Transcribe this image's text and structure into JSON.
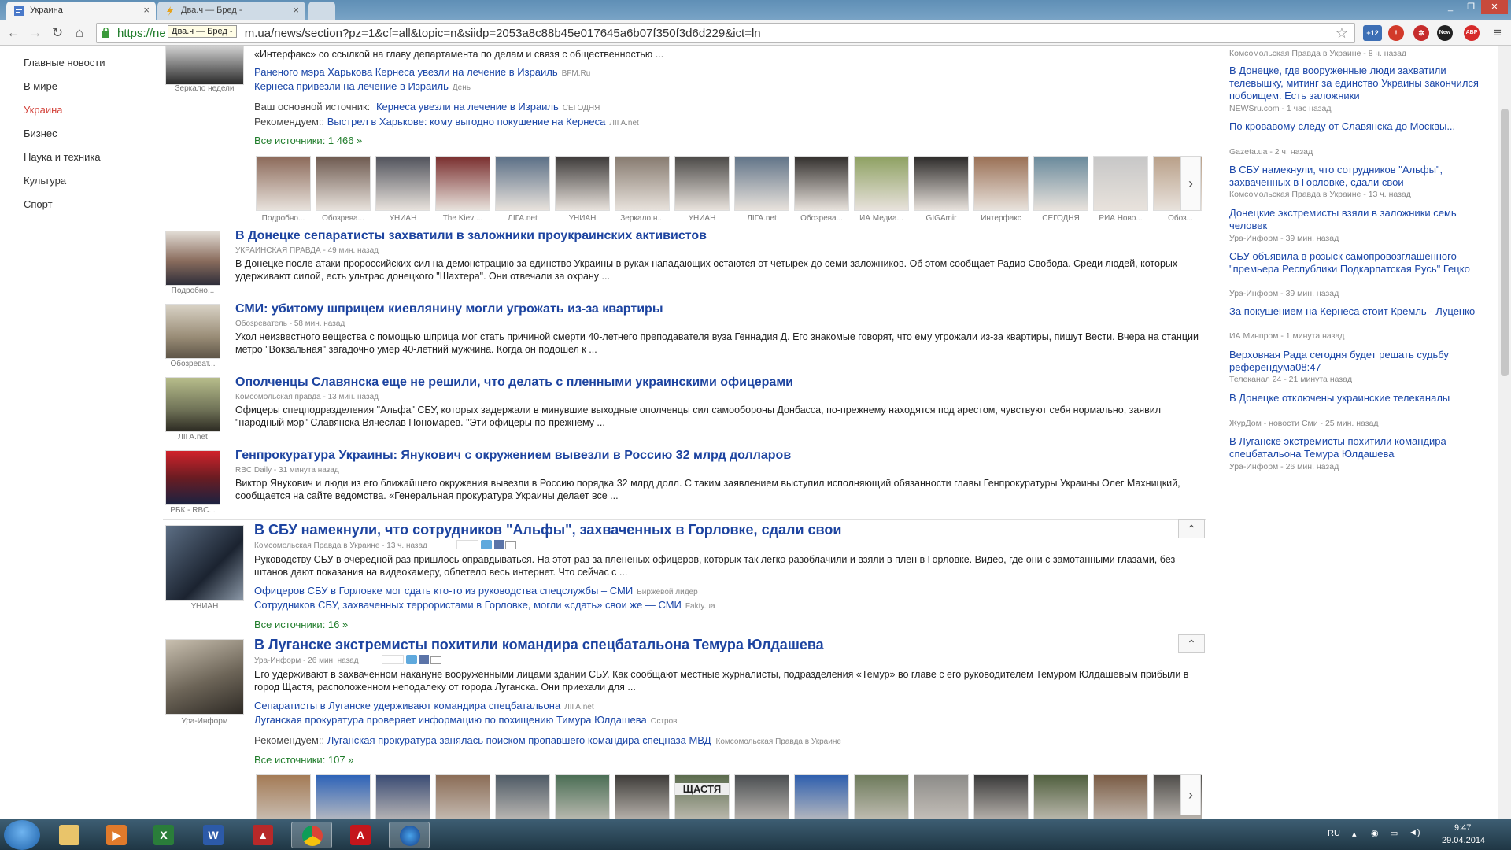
{
  "browser": {
    "tabs": [
      {
        "title": "Украина",
        "active": true
      },
      {
        "title": "Два.ч — Бред -",
        "active": false
      }
    ],
    "url": "https://news.google.com.ua/news/section?pz=1&cf=all&topic=n&siidp=2053a8c88b45e017645a6b07f350f3d6d229&ict=ln",
    "url_visible": "https://ne",
    "url_tail": "m.ua/news/section?pz=1&cf=all&topic=n&siidp=2053a8c88b45e017645a6b07f350f3d6d229&ict=ln",
    "tooltip": "Два.ч — Бред -",
    "ext_badge": "+12",
    "ext_new": "New",
    "ext_abp": "ABP"
  },
  "left_nav": [
    {
      "label": "Главные новости",
      "active": false
    },
    {
      "label": "В мире",
      "active": false
    },
    {
      "label": "Украина",
      "active": true
    },
    {
      "label": "Бизнес",
      "active": false
    },
    {
      "label": "Наука и техника",
      "active": false
    },
    {
      "label": "Культура",
      "active": false
    },
    {
      "label": "Спорт",
      "active": false
    }
  ],
  "story1": {
    "thumb_caption": "Зеркало недели",
    "snippet_tail": "«Интерфакс» со ссылкой на главу департамента по делам и связя с общественностью ...",
    "related": [
      {
        "text": "Раненого мэра Харькова Кернеса увезли на лечение в Израиль",
        "src": "BFM.Ru"
      },
      {
        "text": "Кернеса привезли на лечение в Израиль",
        "src": "День"
      }
    ],
    "main_source_label": "Ваш основной источник:",
    "main_source_link": "Кернеса увезли на лечение в Израиль",
    "main_source_src": "СЕГОДНЯ",
    "recommend_label": "Рекомендуем::",
    "recommend_link": "Выстрел в Харькове: кому выгодно покушение на Кернеса",
    "recommend_src": "ЛIГА.net",
    "all_sources": "Все источники: 1 466 »",
    "strip_captions": [
      "Подробно...",
      "Обозрева...",
      "УНИАН",
      "The Kiev ...",
      "ЛIГА.net",
      "УНИАН",
      "Зеркало н...",
      "УНИАН",
      "ЛIГА.net",
      "Обозрева...",
      "ИА Медиа...",
      "GIGAmir",
      "Интерфакс",
      "СЕГОДНЯ",
      "РИА Ново...",
      "Обоз..."
    ]
  },
  "small_stories": [
    {
      "title": "В Донецке сепаратисты захватили в заложники проукраинских активистов",
      "meta": "УКРАИНСКАЯ ПРАВДА - 49 мин. назад",
      "snippet": "В Донецке после атаки пророссийских сил на демонстрацию за единство Украины в руках нападающих остаются от четырех до семи заложников. Об этом сообщает Радио Свобода. Среди людей, которых удерживают силой, есть ультрас донецкого \"Шахтера\". Они отвечали за охрану ...",
      "thumb_caption": "Подробно..."
    },
    {
      "title": "СМИ: убитому шприцем киевлянину могли угрожать из-за квартиры",
      "meta": "Обозреватель - 58 мин. назад",
      "snippet": "Укол неизвестного вещества с помощью шприца мог стать причиной смерти 40-летнего преподавателя вуза Геннадия Д. Его знакомые говорят, что ему угрожали из-за квартиры, пишут Вести. Вчера на станции метро \"Вокзальная\" загадочно умер 40-летний мужчина. Когда он подошел к ...",
      "thumb_caption": "Обозреват..."
    },
    {
      "title": "Ополченцы Славянска еще не решили, что делать с пленными украинскими офицерами",
      "meta": "Комсомольская правда - 13 мин. назад",
      "snippet": "Офицеры спецподразделения \"Альфа\" СБУ, которых задержали в минувшие выходные ополченцы сил самообороны Донбасса, по-прежнему находятся под арестом, чувствуют себя нормально, заявил \"народный мэр\" Славянска Вячеслав Пономарев. \"Эти офицеры по-прежнему ...",
      "thumb_caption": "ЛIГА.net"
    },
    {
      "title": "Генпрокуратура Украины: Янукович с окружением вывезли в Россию 32 млрд долларов",
      "meta": "RBC Daily - 31 минута назад",
      "snippet": "Виктор Янукович и люди из его ближайшего окружения вывезли в Россию порядка 32 млрд долл. С таким заявлением выступил исполняющий обязанности главы Генпрокуратуры Украины Олег Махницкий, сообщается на сайте ведомства. «Генеральная прокуратура Украины делает все ...",
      "thumb_caption": "РБК - RBC..."
    }
  ],
  "story_sbu": {
    "title": "В СБУ намекнули, что сотрудников \"Альфы\", захваченных в Горловке, сдали свои",
    "meta": "Комсомольская Правда в Украине - 13 ч. назад",
    "snippet": "Руководству СБУ в очередной раз пришлось оправдываться. На этот раз за плененых офицеров, которых так легко разоблачили и взяли в плен в Горловке. Видео, где они с замотанными глазами, без штанов дают показания на видеокамеру, облетело весь интернет. Что сейчас с ...",
    "thumb_caption": "УНИАН",
    "related": [
      {
        "text": "Офицеров СБУ в Горловке мог сдать кто-то из руководства спецслужбы – СМИ",
        "src": "Биржевой лидер"
      },
      {
        "text": "Сотрудников СБУ, захваченных террористами в Горловке, могли «сдать» свои же — СМИ",
        "src": "Fakty.ua"
      }
    ],
    "all_sources": "Все источники: 16 »"
  },
  "story_lugansk": {
    "title": "В Луганске экстремисты похитили командира спецбатальона Темура Юлдашева",
    "meta": "Ура-Информ - 26 мин. назад",
    "snippet": "Его удерживают в захваченном накануне вооруженными лицами здании СБУ. Как сообщают местные журналисты, подразделения «Темур» во главе с его руководителем Темуром Юлдашевым прибыли в город Щастя, расположенном неподалеку от города Луганска. Они приехали для ...",
    "thumb_caption": "Ура-Информ",
    "related": [
      {
        "text": "Сепаратисты в Луганске удерживают командира спецбатальона",
        "src": "ЛIГА.net"
      },
      {
        "text": "Луганская прокуратура проверяет информацию по похищению Тимура Юлдашева",
        "src": "Остров"
      }
    ],
    "recommend_label": "Рекомендуем::",
    "recommend_link": "Луганская прокуратура занялась поиском пропавшего командира спецназа МВД",
    "recommend_src": "Комсомольская Правда в Украине",
    "all_sources": "Все источники: 107 »",
    "strip_sign": "ЩАСТЯ"
  },
  "right_column": [
    {
      "title": "",
      "src": "Комсомольская Правда в Украине - 8 ч. назад"
    },
    {
      "title": "В Донецке, где вооруженные люди захватили телевышку, митинг за единство Украины закончился побоищем. Есть заложники",
      "src": "NEWSru.com - 1 час назад"
    },
    {
      "title": "По кровавому следу от Славянска до Москвы...",
      "src": "Gazeta.ua - 2 ч. назад"
    },
    {
      "title": "В СБУ намекнули, что сотрудников \"Альфы\", захваченных в Горловке, сдали свои",
      "src": "Комсомольская Правда в Украине - 13 ч. назад"
    },
    {
      "title": "Донецкие экстремисты взяли в заложники семь человек",
      "src": "Ура-Информ - 39 мин. назад"
    },
    {
      "title": "СБУ объявила в розыск самопровозглашенного \"премьера Республики Подкарпатская Русь\" Гецко",
      "src": "Ура-Информ - 39 мин. назад"
    },
    {
      "title": "За покушением на Кернеса стоит Кремль - Луценко",
      "src": "ИА Минпром - 1 минута назад"
    },
    {
      "title": "Верховная Рада сегодня будет решать судьбу референдума08:47",
      "src": "Телеканал 24 - 21 минута назад"
    },
    {
      "title": "В Донецке отключены украинские телеканалы",
      "src": "ЖурДом - новости Сми - 25 мин. назад"
    },
    {
      "title": "В Луганске экстремисты похитили командира спецбатальона Темура Юлдашева",
      "src": "Ура-Информ - 26 мин. назад"
    }
  ],
  "taskbar": {
    "lang": "RU",
    "time": "9:47",
    "date": "29.04.2014"
  }
}
